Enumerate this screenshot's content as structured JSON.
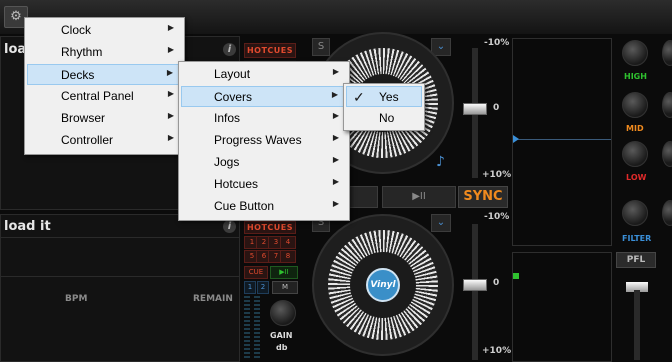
{
  "menus": {
    "main": [
      {
        "label": "Clock"
      },
      {
        "label": "Rhythm"
      },
      {
        "label": "Decks"
      },
      {
        "label": "Central Panel"
      },
      {
        "label": "Browser"
      },
      {
        "label": "Controller"
      }
    ],
    "decks_sub": [
      {
        "label": "Layout"
      },
      {
        "label": "Covers"
      },
      {
        "label": "Infos"
      },
      {
        "label": "Progress Waves"
      },
      {
        "label": "Jogs"
      },
      {
        "label": "Hotcues"
      },
      {
        "label": "Cue Button"
      }
    ],
    "covers_sub": [
      {
        "label": "Yes",
        "checked": true
      },
      {
        "label": "No",
        "checked": false
      }
    ]
  },
  "deck_top": {
    "title": "load it",
    "hotcues_label": "HOTCUES"
  },
  "deck_bottom": {
    "title": "load it",
    "hotcues_label": "HOTCUES",
    "hotcue_numbers": [
      "1",
      "2",
      "3",
      "4",
      "5",
      "6",
      "7",
      "8"
    ],
    "cue_label": "CUE",
    "play_label": "▶II",
    "loop_labels": [
      "1",
      "2",
      "M"
    ],
    "bpm_label": "BPM",
    "remain_label": "REMAIN",
    "gain_label": "GAIN",
    "gain_unit": "db",
    "vinyl_label": "Vinyl"
  },
  "pitch": {
    "top": {
      "minus": "-10%",
      "zero": "0",
      "plus": "+10%"
    },
    "bottom": {
      "minus": "-10%",
      "zero": "0",
      "plus": "+10%"
    }
  },
  "sync_label": "SYNC",
  "mixer": {
    "eq_labels": [
      "HIGH",
      "MID",
      "LOW",
      "FILTER"
    ],
    "eq_colors": [
      "#2fc12f",
      "#f08a1e",
      "#e02a2a",
      "#3a8fd8"
    ],
    "pfl_label": "PFL"
  }
}
